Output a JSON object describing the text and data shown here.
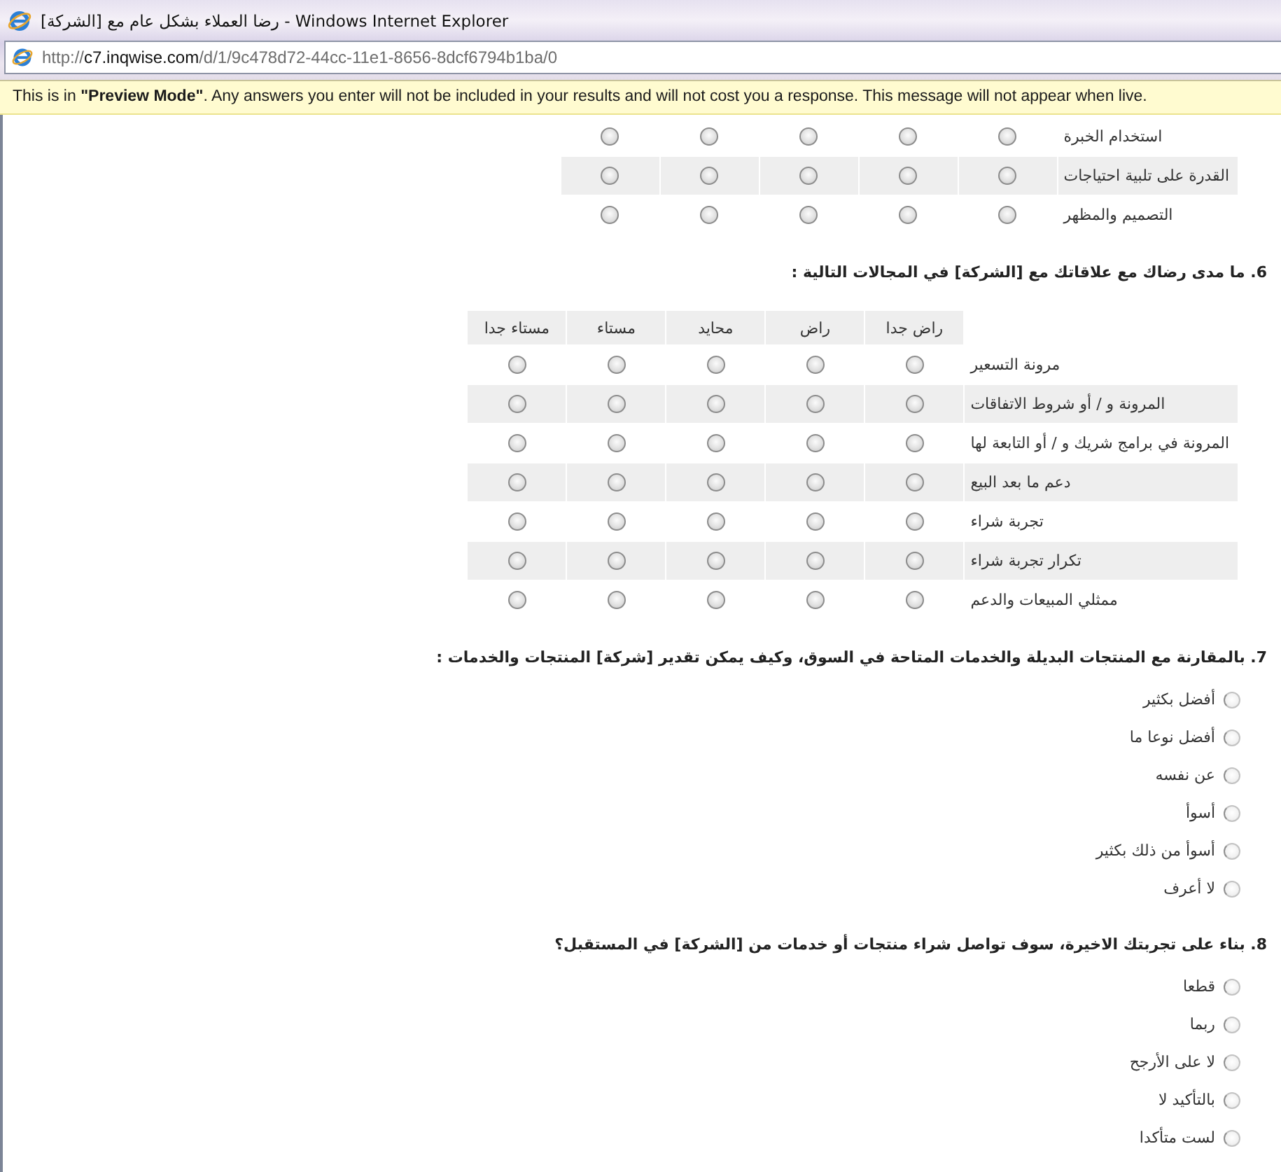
{
  "window": {
    "title": "رضا العملاء بشكل عام مع [الشركة] - Windows Internet Explorer"
  },
  "address_bar": {
    "scheme": "http://",
    "host": "c7.inqwise.com",
    "path": "/d/1/9c478d72-44cc-11e1-8656-8dcf6794b1ba/0"
  },
  "preview_notice": "This is in **\"Preview Mode\"**. Any answers you enter will not be included in your results and will not cost you a response. This message will not appear when live.",
  "questions": [
    {
      "kind": "matrix",
      "rows": [
        {
          "label": "استخدام الخبرة",
          "cells": [
            {
              "selected": false
            },
            {
              "selected": false
            },
            {
              "selected": false
            },
            {
              "selected": false
            },
            {
              "selected": false
            }
          ]
        },
        {
          "label": "القدرة على تلبية احتياجات",
          "cells": [
            {
              "selected": false
            },
            {
              "selected": false
            },
            {
              "selected": false
            },
            {
              "selected": false
            },
            {
              "selected": false
            }
          ]
        },
        {
          "label": "التصميم والمظهر",
          "cells": [
            {
              "selected": false
            },
            {
              "selected": false
            },
            {
              "selected": false
            },
            {
              "selected": false
            },
            {
              "selected": false
            }
          ]
        }
      ]
    },
    {
      "kind": "matrix",
      "title": "6. ما مدى رضاك مع علاقاتك مع [الشركة] في المجالات التالية :",
      "columns": [
        "راض جدا",
        "راض",
        "محايد",
        "مستاء",
        "مستاء جدا"
      ],
      "rows": [
        {
          "label": "مرونة التسعير",
          "cells": [
            {
              "selected": false
            },
            {
              "selected": false
            },
            {
              "selected": false
            },
            {
              "selected": false
            },
            {
              "selected": false
            }
          ]
        },
        {
          "label": "المرونة و / أو شروط الاتفاقات",
          "cells": [
            {
              "selected": false
            },
            {
              "selected": false
            },
            {
              "selected": false
            },
            {
              "selected": false
            },
            {
              "selected": false
            }
          ]
        },
        {
          "label": "المرونة في برامج شريك و / أو التابعة لها",
          "cells": [
            {
              "selected": false
            },
            {
              "selected": false
            },
            {
              "selected": false
            },
            {
              "selected": false
            },
            {
              "selected": false
            }
          ]
        },
        {
          "label": "دعم ما بعد البيع",
          "cells": [
            {
              "selected": false
            },
            {
              "selected": false
            },
            {
              "selected": false
            },
            {
              "selected": false
            },
            {
              "selected": false
            }
          ]
        },
        {
          "label": "تجربة شراء",
          "cells": [
            {
              "selected": false
            },
            {
              "selected": false
            },
            {
              "selected": false
            },
            {
              "selected": false
            },
            {
              "selected": false
            }
          ]
        },
        {
          "label": "تكرار تجربة شراء",
          "cells": [
            {
              "selected": false
            },
            {
              "selected": false
            },
            {
              "selected": false
            },
            {
              "selected": false
            },
            {
              "selected": false
            }
          ]
        },
        {
          "label": "ممثلي المبيعات والدعم",
          "cells": [
            {
              "selected": false
            },
            {
              "selected": false
            },
            {
              "selected": false
            },
            {
              "selected": false
            },
            {
              "selected": false
            }
          ]
        }
      ]
    },
    {
      "kind": "choice",
      "title": "7. بالمقارنة مع المنتجات البديلة والخدمات المتاحة في السوق، وكيف يمكن تقدير [شركة] المنتجات والخدمات :",
      "options": [
        {
          "label": "أفضل بكثير",
          "selected": false
        },
        {
          "label": "أفضل نوعا ما",
          "selected": false
        },
        {
          "label": "عن نفسه",
          "selected": false
        },
        {
          "label": "أسوأ",
          "selected": false
        },
        {
          "label": "أسوأ من ذلك بكثير",
          "selected": false
        },
        {
          "label": "لا أعرف",
          "selected": false
        }
      ]
    },
    {
      "kind": "choice",
      "title": "8. بناء على تجربتك الاخيرة، سوف تواصل شراء منتجات أو خدمات من [الشركة] في المستقبل؟",
      "options": [
        {
          "label": "قطعا",
          "selected": false
        },
        {
          "label": "ربما",
          "selected": false
        },
        {
          "label": "لا على الأرجح",
          "selected": false
        },
        {
          "label": "بالتأكيد لا",
          "selected": false
        },
        {
          "label": "لست متأكدا",
          "selected": false
        }
      ]
    }
  ]
}
